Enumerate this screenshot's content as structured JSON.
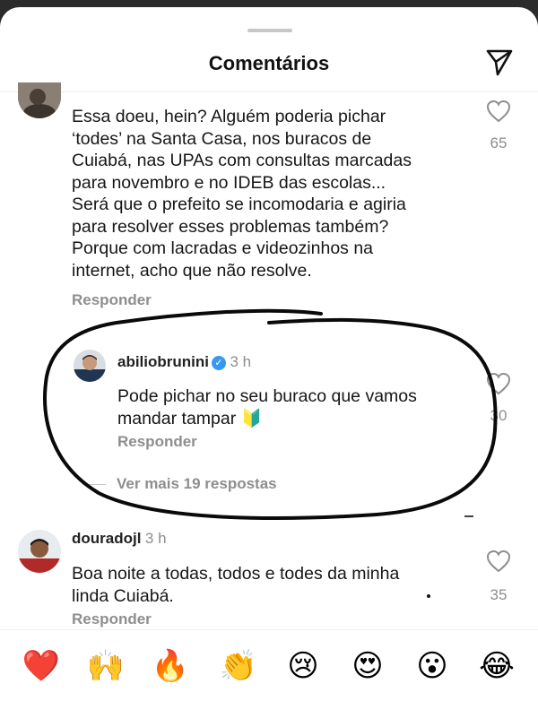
{
  "header": {
    "title": "Comentários"
  },
  "comment1": {
    "lines": [
      "Essa doeu, hein? Alguém poderia pichar",
      "‘todes’ na Santa Casa, nos buracos de",
      "Cuiabá, nas UPAs com consultas marcadas",
      "para novembro e no IDEB das escolas...",
      "Será que o prefeito se incomodaria e agiria",
      "para resolver esses problemas também?",
      "Porque com lacradas e videozinhos na",
      "internet, acho que não resolve."
    ],
    "reply_label": "Responder",
    "likes": "65"
  },
  "reply1": {
    "username": "abiliobrunini",
    "verified_icon": "verified-badge-icon",
    "time": "3 h",
    "lines": [
      "Pode pichar no seu buraco que vamos",
      "mandar tampar 🔰"
    ],
    "reply_label": "Responder",
    "likes": "30"
  },
  "more_replies": "Ver mais 19 respostas",
  "comment2": {
    "username": "douradojl",
    "time": "3 h",
    "lines": [
      "Boa noite a todas, todos e todes da minha",
      "linda Cuiabá."
    ],
    "reply_label": "Responder",
    "likes": "35"
  },
  "emoji_bar": [
    "❤️",
    "🙌",
    "🔥",
    "👏",
    "😢",
    "😍",
    "😮",
    "😂"
  ],
  "colors": {
    "annotation": "#0a0a0a",
    "muted": "#8e8e8e",
    "verified": "#3897f0"
  }
}
